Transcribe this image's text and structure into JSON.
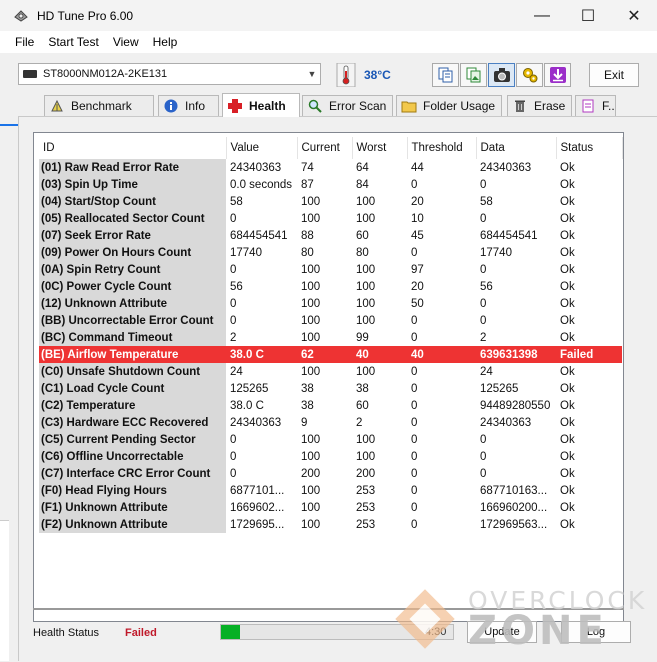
{
  "window": {
    "title": "HD Tune Pro 6.00",
    "minimize": "—",
    "maximize": "☐",
    "close": "✕"
  },
  "menu": [
    "File",
    "Start Test",
    "View",
    "Help"
  ],
  "toolbar": {
    "drive": "ST8000NM012A-2KE131",
    "temperature": "38°C",
    "exit_label": "Exit",
    "colors": {
      "temperature": "#1a57b5"
    }
  },
  "tabs": [
    {
      "label": "Benchmark",
      "icon": "benchmark-icon"
    },
    {
      "label": "Info",
      "icon": "info-icon"
    },
    {
      "label": "Health",
      "icon": "health-cross-icon",
      "active": true
    },
    {
      "label": "Error Scan",
      "icon": "magnifier-icon"
    },
    {
      "label": "Folder Usage",
      "icon": "folder-icon"
    },
    {
      "label": "Erase",
      "icon": "trash-icon"
    },
    {
      "label": "F..",
      "icon": "file-icon"
    }
  ],
  "health": {
    "columns": [
      "ID",
      "Value",
      "Current",
      "Worst",
      "Threshold",
      "Data",
      "Status"
    ],
    "rows": [
      [
        "(01) Raw Read Error Rate",
        "24340363",
        "74",
        "64",
        "44",
        "24340363",
        "Ok"
      ],
      [
        "(03) Spin Up Time",
        "0.0 seconds",
        "87",
        "84",
        "0",
        "0",
        "Ok"
      ],
      [
        "(04) Start/Stop Count",
        "58",
        "100",
        "100",
        "20",
        "58",
        "Ok"
      ],
      [
        "(05) Reallocated Sector Count",
        "0",
        "100",
        "100",
        "10",
        "0",
        "Ok"
      ],
      [
        "(07) Seek Error Rate",
        "684454541",
        "88",
        "60",
        "45",
        "684454541",
        "Ok"
      ],
      [
        "(09) Power On Hours Count",
        "17740",
        "80",
        "80",
        "0",
        "17740",
        "Ok"
      ],
      [
        "(0A) Spin Retry Count",
        "0",
        "100",
        "100",
        "97",
        "0",
        "Ok"
      ],
      [
        "(0C) Power Cycle Count",
        "56",
        "100",
        "100",
        "20",
        "56",
        "Ok"
      ],
      [
        "(12) Unknown Attribute",
        "0",
        "100",
        "100",
        "50",
        "0",
        "Ok"
      ],
      [
        "(BB) Uncorrectable Error Count",
        "0",
        "100",
        "100",
        "0",
        "0",
        "Ok"
      ],
      [
        "(BC) Command Timeout",
        "2",
        "100",
        "99",
        "0",
        "2",
        "Ok"
      ],
      [
        "(BE) Airflow Temperature",
        "38.0 C",
        "62",
        "40",
        "40",
        "639631398",
        "Failed"
      ],
      [
        "(C0) Unsafe Shutdown Count",
        "24",
        "100",
        "100",
        "0",
        "24",
        "Ok"
      ],
      [
        "(C1) Load Cycle Count",
        "125265",
        "38",
        "38",
        "0",
        "125265",
        "Ok"
      ],
      [
        "(C2) Temperature",
        "38.0 C",
        "38",
        "60",
        "0",
        "94489280550",
        "Ok"
      ],
      [
        "(C3) Hardware ECC Recovered",
        "24340363",
        "9",
        "2",
        "0",
        "24340363",
        "Ok"
      ],
      [
        "(C5) Current Pending Sector",
        "0",
        "100",
        "100",
        "0",
        "0",
        "Ok"
      ],
      [
        "(C6) Offline Uncorrectable",
        "0",
        "100",
        "100",
        "0",
        "0",
        "Ok"
      ],
      [
        "(C7) Interface CRC Error Count",
        "0",
        "200",
        "200",
        "0",
        "0",
        "Ok"
      ],
      [
        "(F0) Head Flying Hours",
        "6877101...",
        "100",
        "253",
        "0",
        "687710163...",
        "Ok"
      ],
      [
        "(F1) Unknown Attribute",
        "1669602...",
        "100",
        "253",
        "0",
        "166960200...",
        "Ok"
      ],
      [
        "(F2) Unknown Attribute",
        "1729695...",
        "100",
        "253",
        "0",
        "172969563...",
        "Ok"
      ]
    ],
    "failed_row_color": "#ee3333"
  },
  "status": {
    "health_label": "Health Status",
    "health_value": "Failed",
    "health_value_color": "#c0192a",
    "progress": 0.08,
    "time": "4:30",
    "update_label": "Update",
    "log_label": "Log"
  },
  "watermark": {
    "line1": "OVERCLOCK",
    "line2": "ZONE"
  }
}
